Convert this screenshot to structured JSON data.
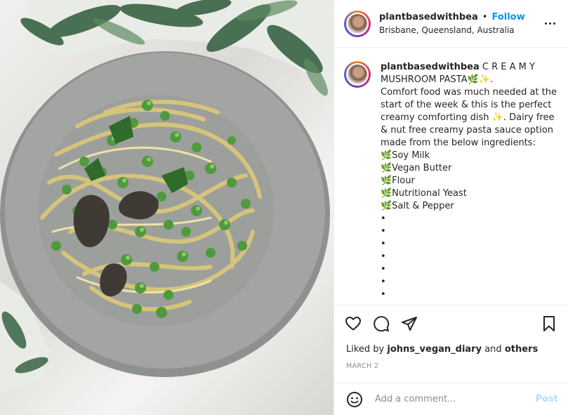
{
  "header": {
    "username": "plantbasedwithbea",
    "separator": "•",
    "follow_label": "Follow",
    "location": "Brisbane, Queensland, Australia"
  },
  "caption": {
    "username": "plantbasedwithbea",
    "text": " C R E A M Y MUSHROOM PASTA🌿✨.\nComfort food was much needed at the start of the week & this is the perfect creamy comforting dish ✨. Dairy free & nut free creamy pasta sauce option made from the below ingredients:\n🌿Soy Milk\n🌿Vegan Butter\n🌿Flour\n🌿Nutritional Yeast\n🌿Salt & Pepper\n•\n•\n•\n•\n•\n•\n•"
  },
  "icons": {
    "like": "heart-icon",
    "comment": "comment-icon",
    "share": "share-icon",
    "save": "bookmark-icon",
    "more": "more-options-icon",
    "emoji": "emoji-icon"
  },
  "likes": {
    "prefix": "Liked by ",
    "user": "johns_vegan_diary",
    "middle": " and ",
    "others": "others"
  },
  "date": "MARCH 2",
  "comment_box": {
    "placeholder": "Add a comment...",
    "post_label": "Post"
  },
  "colors": {
    "accent": "#0095f6",
    "post_disabled": "#b2dffc",
    "muted": "#8e8e8e"
  }
}
